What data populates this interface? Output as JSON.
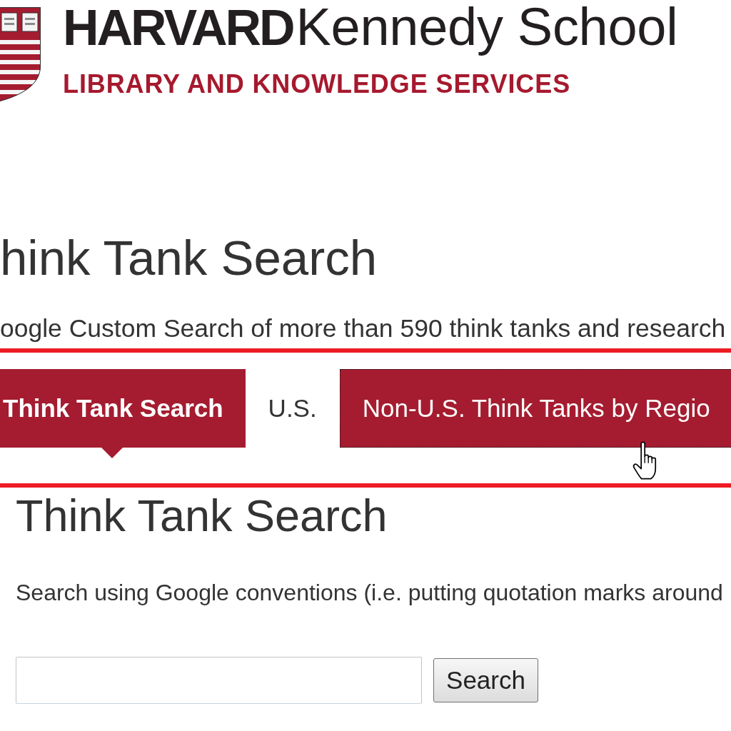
{
  "header": {
    "wordmark_bold": "HARVARD",
    "wordmark_regular": "Kennedy School",
    "subtitle": "LIBRARY AND KNOWLEDGE SERVICES"
  },
  "page_title": "hink Tank Search",
  "intro": "oogle Custom Search of more than 590 think tanks and research",
  "tabs": [
    {
      "label": "Think Tank Search",
      "selected": true,
      "hovered": false
    },
    {
      "label": "U.S.",
      "selected": false,
      "hovered": false
    },
    {
      "label": "Non-U.S. Think Tanks by Regio",
      "selected": false,
      "hovered": true
    }
  ],
  "panel": {
    "title": "Think Tank Search",
    "instructions": "Search using Google conventions (i.e. putting quotation marks around",
    "search": {
      "button": "Search"
    }
  },
  "cursor": {
    "kind": "hand"
  }
}
